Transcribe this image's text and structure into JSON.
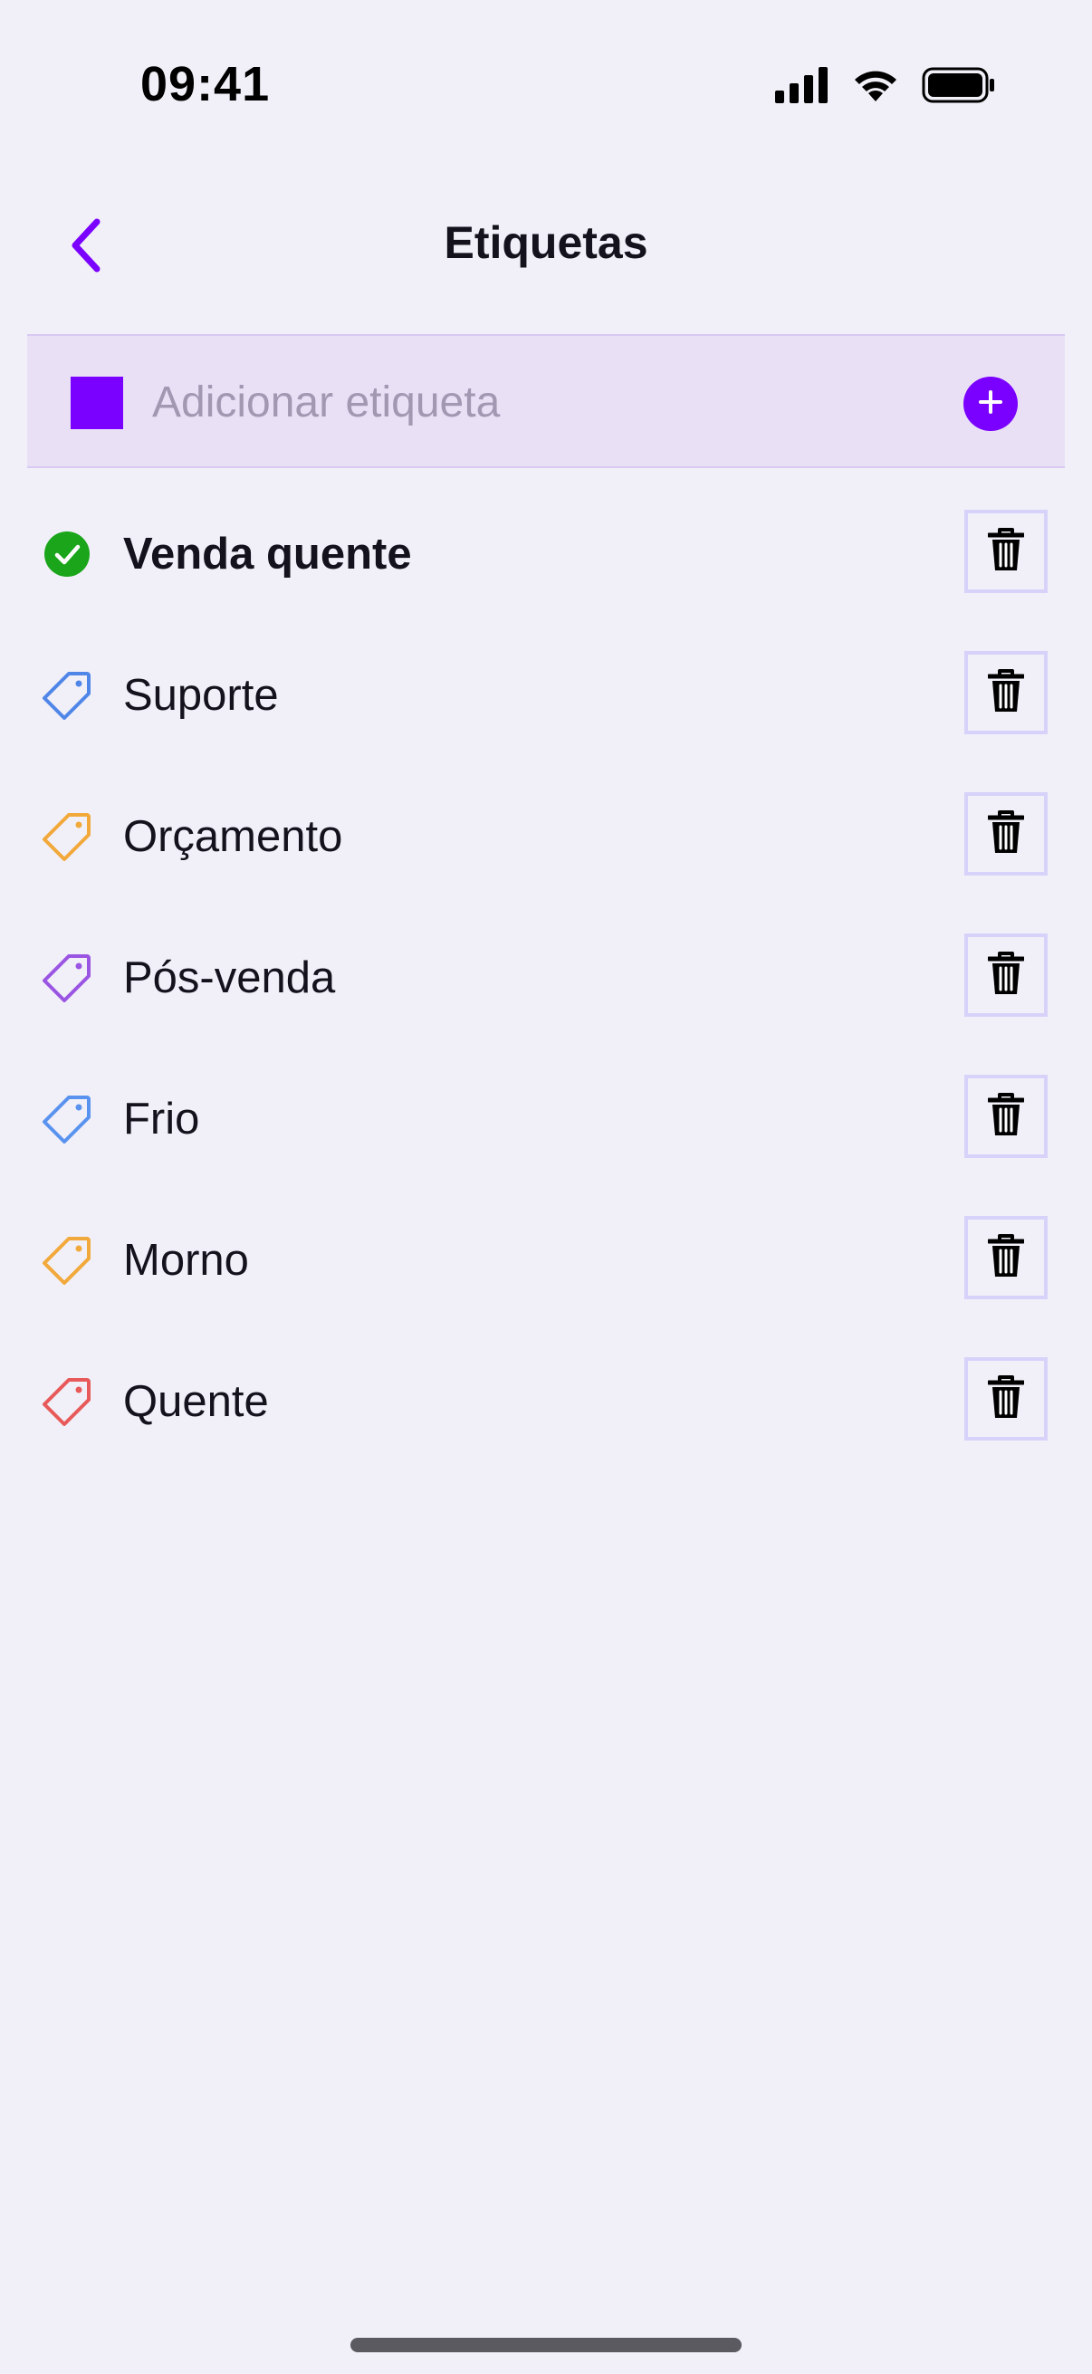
{
  "status_bar": {
    "time": "09:41",
    "icons": [
      "signal-icon",
      "wifi-icon",
      "battery-icon"
    ]
  },
  "nav": {
    "back_icon": "chevron-left-icon",
    "title": "Etiquetas"
  },
  "add_tag": {
    "placeholder": "Adicionar etiqueta",
    "value": "",
    "swatch_color": "#7a00ff",
    "add_icon": "plus-icon"
  },
  "tags": [
    {
      "label": "Venda quente",
      "icon": "check-circle-icon",
      "color": "#1aa51a",
      "selected": true
    },
    {
      "label": "Suporte",
      "icon": "tag-icon",
      "color": "#4f86e8",
      "selected": false
    },
    {
      "label": "Orçamento",
      "icon": "tag-icon",
      "color": "#f2a93b",
      "selected": false
    },
    {
      "label": "Pós-venda",
      "icon": "tag-icon",
      "color": "#9a55e3",
      "selected": false
    },
    {
      "label": "Frio",
      "icon": "tag-icon",
      "color": "#5a93ef",
      "selected": false
    },
    {
      "label": "Morno",
      "icon": "tag-icon",
      "color": "#f2a93b",
      "selected": false
    },
    {
      "label": "Quente",
      "icon": "tag-icon",
      "color": "#e85a5a",
      "selected": false
    }
  ],
  "colors": {
    "accent": "#7a00ff",
    "background": "#f1f0f8",
    "add_bar_background": "#e9e0f6",
    "delete_border": "#d6d2fa"
  }
}
